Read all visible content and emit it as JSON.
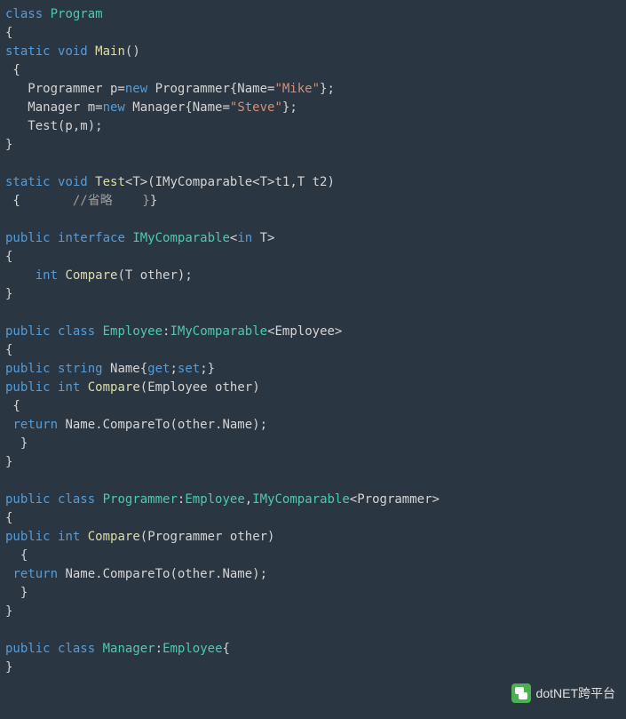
{
  "code": {
    "l1_kw1": "class",
    "l1_type": "Program",
    "l2": "{",
    "l3_kw1": "static",
    "l3_kw2": "void",
    "l3_method": "Main",
    "l3_tail": "()",
    "l4": " {",
    "l5_p1": "   Programmer p=",
    "l5_kw": "new",
    "l5_p2": " Programmer{Name=",
    "l5_str": "\"Mike\"",
    "l5_p3": "};",
    "l6_p1": "   Manager m=",
    "l6_kw": "new",
    "l6_p2": " Manager{Name=",
    "l6_str": "\"Steve\"",
    "l6_p3": "};",
    "l7": "   Test(p,m);",
    "l8": "}",
    "l10_kw1": "static",
    "l10_kw2": "void",
    "l10_method": "Test",
    "l10_p1": "<T>(IMyComparable<T>t1,T t2)",
    "l11_p1": " {       ",
    "l11_comment": "//省略    }",
    "l11_p2": "}",
    "l13_kw1": "public",
    "l13_kw2": "interface",
    "l13_type": "IMyComparable",
    "l13_p1": "<",
    "l13_kw3": "in",
    "l13_p2": " T>",
    "l14": "{",
    "l15_p1": "    ",
    "l15_kw": "int",
    "l15_method": "Compare",
    "l15_p2": "(T other);",
    "l16": "}",
    "l18_kw1": "public",
    "l18_kw2": "class",
    "l18_type1": "Employee",
    "l18_p1": ":",
    "l18_type2": "IMyComparable",
    "l18_p2": "<Employee>",
    "l19": "{",
    "l20_kw1": "public",
    "l20_kw2": "string",
    "l20_p1": " Name{",
    "l20_kw3": "get",
    "l20_p2": ";",
    "l20_kw4": "set",
    "l20_p3": ";}",
    "l21_kw1": "public",
    "l21_kw2": "int",
    "l21_method": "Compare",
    "l21_p1": "(Employee other)",
    "l22": " {",
    "l23_kw": "return",
    "l23_p1": " Name.CompareTo(other.Name);",
    "l24": "  }",
    "l25": "}",
    "l27_kw1": "public",
    "l27_kw2": "class",
    "l27_type1": "Programmer",
    "l27_p1": ":",
    "l27_type2": "Employee",
    "l27_p2": ",",
    "l27_type3": "IMyComparable",
    "l27_p3": "<Programmer>",
    "l28": "{",
    "l29_kw1": "public",
    "l29_kw2": "int",
    "l29_method": "Compare",
    "l29_p1": "(Programmer other)",
    "l30": "  {",
    "l31_kw": "return",
    "l31_p1": " Name.CompareTo(other.Name);",
    "l32": "  }",
    "l33": "}",
    "l35_kw1": "public",
    "l35_kw2": "class",
    "l35_type": "Manager",
    "l35_p1": ":",
    "l35_type2": "Employee",
    "l35_p2": "{",
    "l36": "}"
  },
  "watermark": {
    "text": "dotNET跨平台"
  }
}
